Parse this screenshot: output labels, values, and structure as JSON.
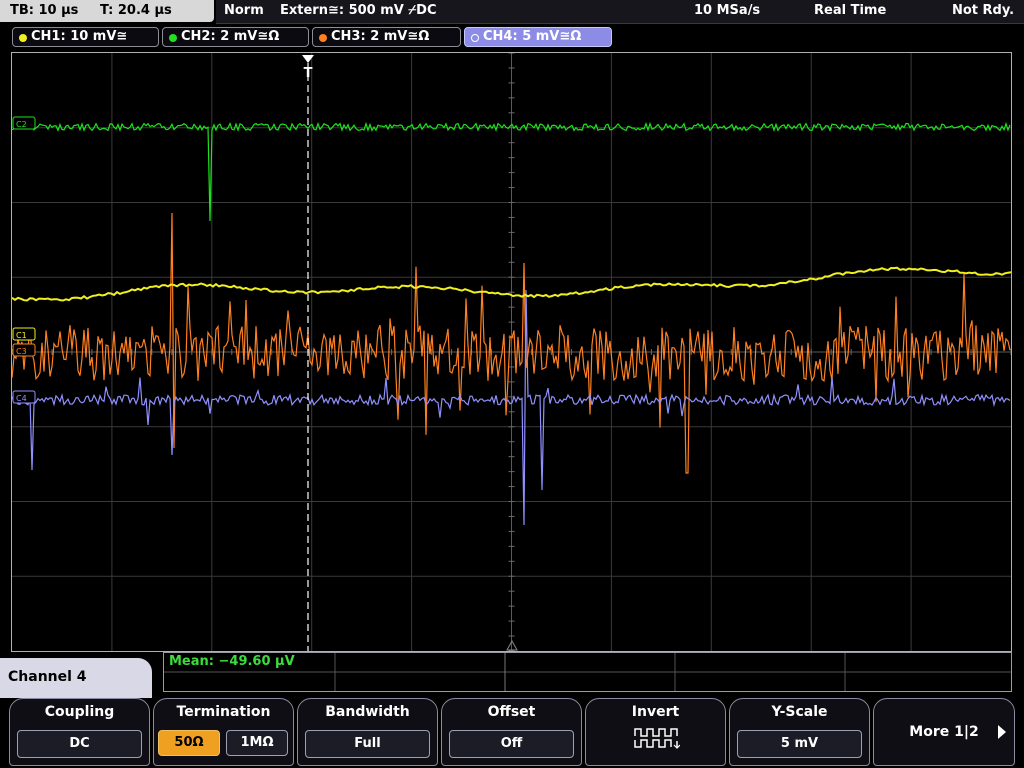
{
  "topbar": {
    "timebase": "TB: 10 µs",
    "trigger_time": "T: 20.4 µs",
    "mode": "Norm",
    "trigger_source": "Extern≅: 500 mV ⌿DC",
    "sample_rate": "10 MSa/s",
    "acq_mode": "Real Time",
    "status": "Not Rdy."
  },
  "channels": [
    {
      "label": "CH1: 10 mV≅",
      "color": "#f0f020"
    },
    {
      "label": "CH2: 2 mV≅Ω",
      "color": "#20e020"
    },
    {
      "label": "CH3: 2 mV≅Ω",
      "color": "#ff8020"
    },
    {
      "label": "CH4: 5 mV≅Ω",
      "color": "#9090ff"
    }
  ],
  "screen": {
    "trigger_marker": "T",
    "channel_markers": [
      "C1",
      "C2",
      "C3",
      "C4"
    ]
  },
  "measurement": {
    "text": "Mean: −49.60 µV"
  },
  "menu": {
    "channel_title": "Channel 4",
    "coupling": {
      "title": "Coupling",
      "value": "DC"
    },
    "termination": {
      "title": "Termination",
      "option_a": "50Ω",
      "option_b": "1MΩ"
    },
    "bandwidth": {
      "title": "Bandwidth",
      "value": "Full"
    },
    "offset": {
      "title": "Offset",
      "value": "Off"
    },
    "invert": {
      "title": "Invert",
      "icon": "invert-signal-icon"
    },
    "yscale": {
      "title": "Y-Scale",
      "value": "5 mV"
    },
    "more": {
      "title": "More 1|2"
    }
  }
}
